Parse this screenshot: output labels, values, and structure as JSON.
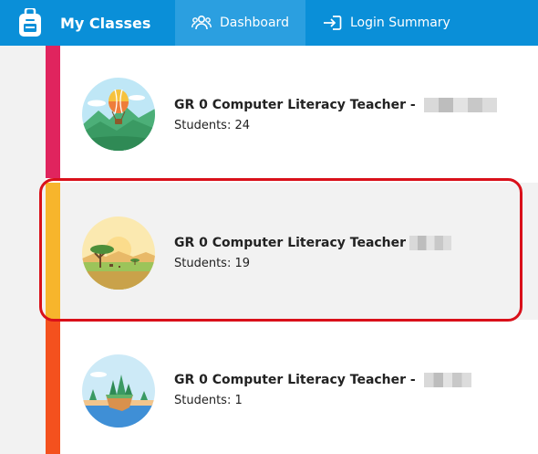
{
  "header": {
    "app_title": "My Classes",
    "brand_icon": "backpack-icon",
    "nav": [
      {
        "label": "Dashboard",
        "icon": "users-icon",
        "active": true
      },
      {
        "label": "Login Summary",
        "icon": "login-arrow-icon",
        "active": false
      }
    ]
  },
  "classes": [
    {
      "title": "GR 0 Computer Literacy Teacher - ",
      "students": "Students: 24",
      "stripe_color": "#e0245e",
      "avatar": "hot-air-balloon-mountains"
    },
    {
      "title": "GR 0 Computer Literacy Teacher",
      "students": "Students: 19",
      "stripe_color": "#f7b52c",
      "avatar": "savanna-tree",
      "selected": true
    },
    {
      "title": "GR 0 Computer Literacy Teacher - ",
      "students": "Students: 1",
      "stripe_color": "#f4511e",
      "avatar": "floating-island"
    }
  ],
  "colors": {
    "header": "#0a8fd8",
    "highlight": "#d9101a"
  }
}
